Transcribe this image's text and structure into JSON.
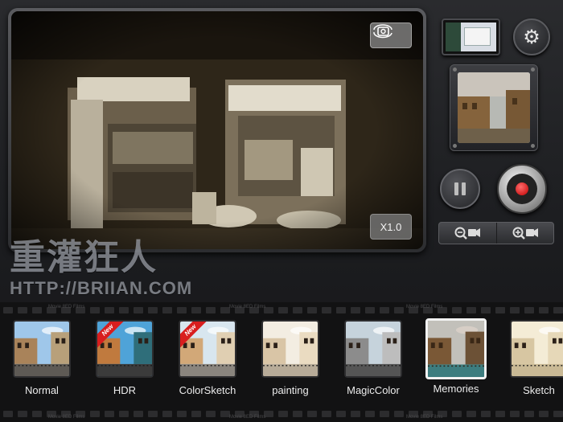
{
  "viewfinder": {
    "zoom_level": "X1.0",
    "camera_switch_icon": "camera-rotate-icon"
  },
  "controls": {
    "settings_icon": "gear-icon",
    "pause_icon": "pause-icon",
    "record_icon": "record-icon",
    "zoom_out_icon": "zoom-out-camera-icon",
    "zoom_in_icon": "zoom-in-camera-icon",
    "record_color": "#d00000"
  },
  "watermark": {
    "title": "重灌狂人",
    "url": "HTTP://BRIIAN.COM"
  },
  "filmstrip": {
    "edge_label": "Movie 8ED Films",
    "filters": [
      {
        "name": "Normal",
        "badge": "",
        "selected": false
      },
      {
        "name": "HDR",
        "badge": "New",
        "selected": false
      },
      {
        "name": "ColorSketch",
        "badge": "New",
        "selected": false
      },
      {
        "name": "painting",
        "badge": "",
        "selected": false
      },
      {
        "name": "MagicColor",
        "badge": "",
        "selected": false
      },
      {
        "name": "Memories",
        "badge": "",
        "selected": true
      },
      {
        "name": "Sketch",
        "badge": "",
        "selected": false
      }
    ]
  }
}
